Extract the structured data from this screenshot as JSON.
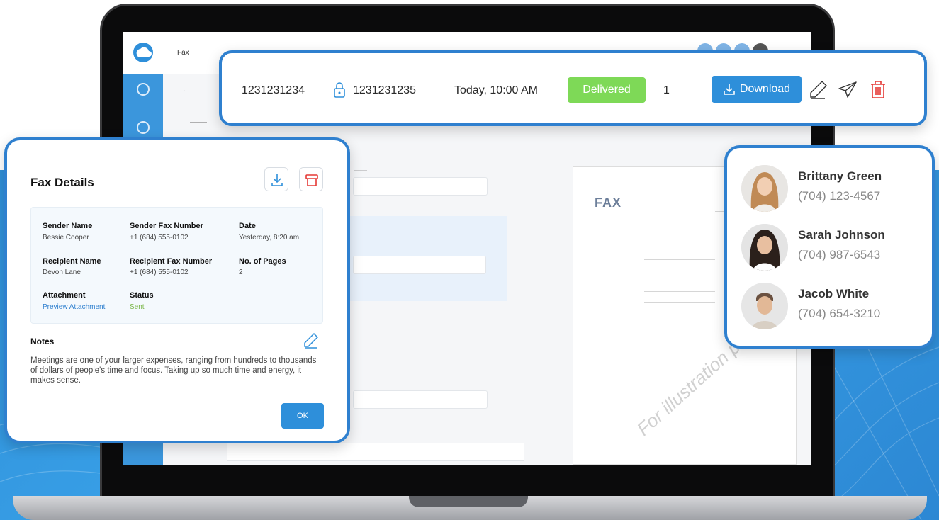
{
  "fax_row": {
    "from_number": "1231231234",
    "to_number": "1231231235",
    "timestamp": "Today, 10:00 AM",
    "status": "Delivered",
    "pages": "1",
    "download_label": "Download"
  },
  "fax_details": {
    "title": "Fax Details",
    "fields": {
      "sender_name_label": "Sender Name",
      "sender_name": "Bessie Cooper",
      "sender_fax_label": "Sender Fax Number",
      "sender_fax": "+1 (684) 555-0102",
      "date_label": "Date",
      "date": "Yesterday, 8:20 am",
      "recipient_name_label": "Recipient Name",
      "recipient_name": "Devon Lane",
      "recipient_fax_label": "Recipient Fax Number",
      "recipient_fax": "+1 (684) 555-0102",
      "pages_label": "No. of Pages",
      "pages": "2",
      "attachment_label": "Attachment",
      "attachment": "Preview Attachment",
      "status_label": "Status",
      "status": "Sent"
    },
    "notes_label": "Notes",
    "notes_text": "Meetings are one of your larger expenses, ranging from hundreds to thousands of dollars of people's time and focus. Taking up so much time and energy, it makes sense.",
    "ok_label": "OK"
  },
  "contacts": [
    {
      "name": "Brittany Green",
      "phone": "(704) 123-4567"
    },
    {
      "name": "Sarah Johnson",
      "phone": "(704) 987-6543"
    },
    {
      "name": "Jacob White",
      "phone": "(704) 654-3210"
    }
  ],
  "background_app": {
    "title": "Fax",
    "fax_word": "FAX",
    "watermark": "For illustration purpose"
  },
  "colors": {
    "accent": "#2e8fda",
    "delivered": "#7ed957",
    "delete": "#e53935",
    "card_border": "#2f80cf"
  },
  "icons": {
    "lock": "lock-icon",
    "download": "download-icon",
    "edit": "pencil-icon",
    "send": "paper-plane-icon",
    "delete": "trash-icon",
    "archive": "archive-icon"
  }
}
